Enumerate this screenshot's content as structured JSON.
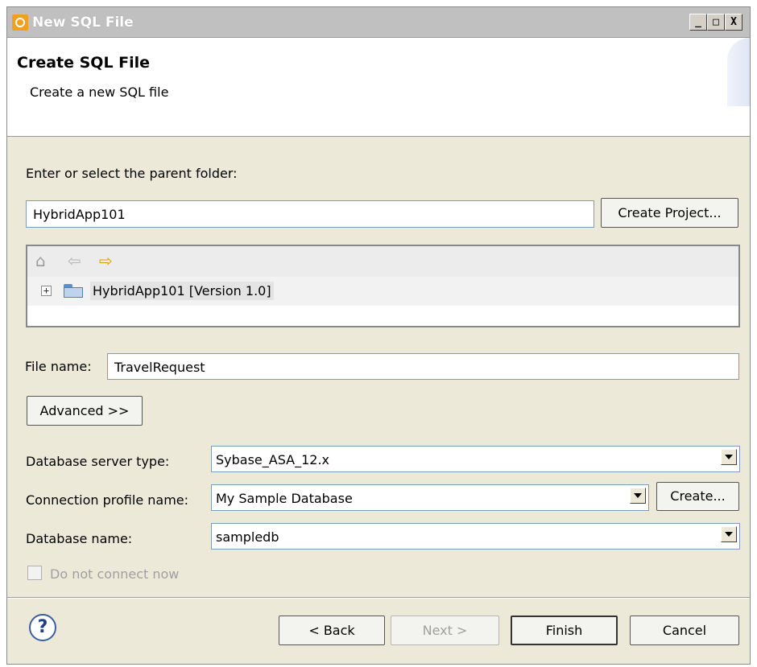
{
  "window": {
    "title": "New SQL File"
  },
  "header": {
    "title": "Create SQL File",
    "subtitle": "Create a new SQL file"
  },
  "folder": {
    "label": "Enter or select the parent folder:",
    "value": "HybridApp101",
    "create_project_label": "Create Project..."
  },
  "tree": {
    "items": [
      {
        "label": "HybridApp101 [Version 1.0]",
        "icon": "open-folder-icon",
        "expanded": false
      }
    ]
  },
  "file_name": {
    "label": "File name:",
    "value": "TravelRequest"
  },
  "advanced_label": "Advanced >>",
  "db_server_type": {
    "label": "Database server type:",
    "value": "Sybase_ASA_12.x"
  },
  "connection_profile": {
    "label": "Connection profile name:",
    "value": "My Sample Database",
    "create_label": "Create..."
  },
  "database_name": {
    "label": "Database name:",
    "value": "sampledb"
  },
  "do_not_connect": {
    "label": "Do not connect now",
    "checked": false,
    "enabled": false
  },
  "buttons": {
    "help": "?",
    "back": "< Back",
    "next": "Next >",
    "finish": "Finish",
    "cancel": "Cancel"
  },
  "title_buttons": {
    "minimize": "_",
    "maximize": "□",
    "close": "X"
  }
}
